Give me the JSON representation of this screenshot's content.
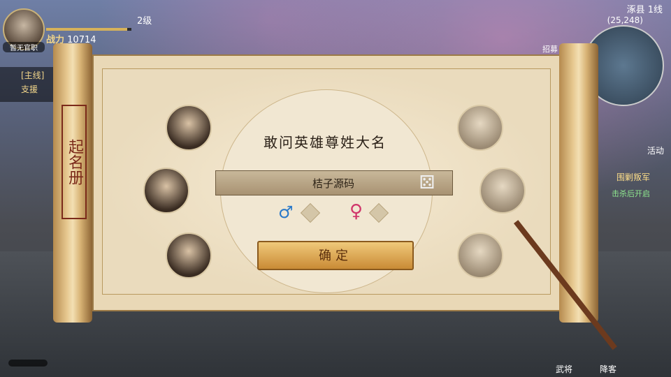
{
  "hud": {
    "avatar_label": "暂无官职",
    "level": "2级",
    "xp_fraction": 0.95,
    "power_label": "战力",
    "power_value": "10714",
    "quest_label": "[主线]",
    "quest_sub": "支援",
    "server": "涿县 1线",
    "coords": "(25,248)",
    "recruit_label": "招募",
    "activity_label": "活动",
    "rebel_label": "围剿叛军",
    "respawn_label": "击杀后开启",
    "generals_label": "武将",
    "surrender_label": "降客"
  },
  "dialog": {
    "seal_text": "起名册",
    "title": "敢问英雄尊姓大名",
    "name_value": "桔子源码",
    "confirm_label": "确定",
    "male_symbol": "♂",
    "female_symbol": "♀",
    "dice_symbol": "⚄"
  }
}
